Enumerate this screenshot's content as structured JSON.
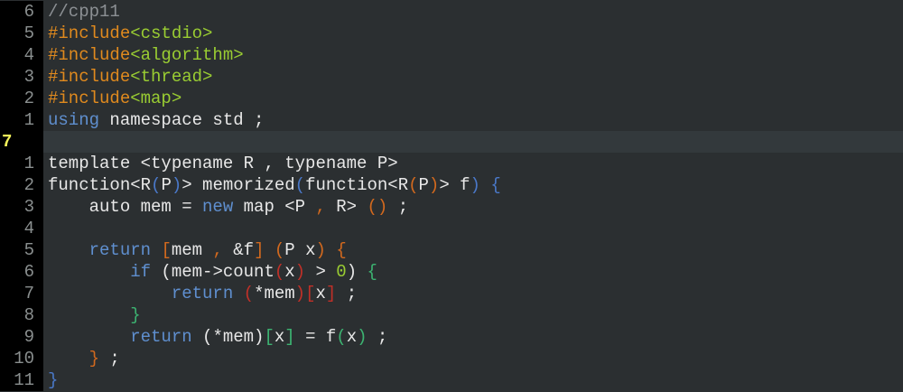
{
  "editor": {
    "colors": {
      "background": "#2b2f31",
      "gutter": "#000000",
      "current_line": "#33393c",
      "default_text": "#e8e8e8",
      "line_number": "#8a8f8f",
      "current_line_number": "#f4f35a",
      "comment": "#8c9094",
      "preproc": "#e08a1e",
      "header": "#9acd32",
      "keyword": "#5f8fcf",
      "paren_blue": "#4a78c8",
      "paren_orange": "#d2691e",
      "paren_red": "#c03028",
      "paren_green": "#3cb371",
      "number": "#9acd32"
    },
    "lines": [
      {
        "number": "6",
        "tokens": [
          {
            "t": "//cpp11",
            "c": "comment"
          }
        ]
      },
      {
        "number": "5",
        "tokens": [
          {
            "t": "#include",
            "c": "preproc"
          },
          {
            "t": "<cstdio>",
            "c": "header"
          }
        ]
      },
      {
        "number": "4",
        "tokens": [
          {
            "t": "#include",
            "c": "preproc"
          },
          {
            "t": "<algorithm>",
            "c": "header"
          }
        ]
      },
      {
        "number": "3",
        "tokens": [
          {
            "t": "#include",
            "c": "preproc"
          },
          {
            "t": "<thread>",
            "c": "header"
          }
        ]
      },
      {
        "number": "2",
        "tokens": [
          {
            "t": "#include",
            "c": "preproc"
          },
          {
            "t": "<map>",
            "c": "header"
          }
        ]
      },
      {
        "number": "1",
        "tokens": [
          {
            "t": "using",
            "c": "keyword"
          },
          {
            "t": " namespace std ;",
            "c": "default_text"
          }
        ]
      },
      {
        "number": "7",
        "current": true,
        "tokens": []
      },
      {
        "number": "1",
        "tokens": [
          {
            "t": "template <typename R , typename P>",
            "c": "default_text"
          }
        ]
      },
      {
        "number": "2",
        "tokens": [
          {
            "t": "function<R",
            "c": "default_text"
          },
          {
            "t": "(",
            "c": "paren_blue"
          },
          {
            "t": "P",
            "c": "default_text"
          },
          {
            "t": ")",
            "c": "paren_blue"
          },
          {
            "t": "> memorized",
            "c": "default_text"
          },
          {
            "t": "(",
            "c": "paren_blue"
          },
          {
            "t": "function<R",
            "c": "default_text"
          },
          {
            "t": "(",
            "c": "paren_orange"
          },
          {
            "t": "P",
            "c": "default_text"
          },
          {
            "t": ")",
            "c": "paren_orange"
          },
          {
            "t": "> f",
            "c": "default_text"
          },
          {
            "t": ")",
            "c": "paren_blue"
          },
          {
            "t": " ",
            "c": "default_text"
          },
          {
            "t": "{",
            "c": "paren_blue"
          }
        ]
      },
      {
        "number": "3",
        "tokens": [
          {
            "t": "    auto mem = ",
            "c": "default_text"
          },
          {
            "t": "new",
            "c": "keyword"
          },
          {
            "t": " map <P ",
            "c": "default_text"
          },
          {
            "t": ",",
            "c": "paren_orange"
          },
          {
            "t": " R> ",
            "c": "default_text"
          },
          {
            "t": "()",
            "c": "paren_orange"
          },
          {
            "t": " ;",
            "c": "default_text"
          }
        ]
      },
      {
        "number": "4",
        "tokens": []
      },
      {
        "number": "5",
        "tokens": [
          {
            "t": "    ",
            "c": "default_text"
          },
          {
            "t": "return",
            "c": "keyword"
          },
          {
            "t": " ",
            "c": "default_text"
          },
          {
            "t": "[",
            "c": "paren_orange"
          },
          {
            "t": "mem ",
            "c": "default_text"
          },
          {
            "t": ",",
            "c": "paren_orange"
          },
          {
            "t": " &f",
            "c": "default_text"
          },
          {
            "t": "]",
            "c": "paren_orange"
          },
          {
            "t": " ",
            "c": "default_text"
          },
          {
            "t": "(",
            "c": "paren_orange"
          },
          {
            "t": "P x",
            "c": "default_text"
          },
          {
            "t": ")",
            "c": "paren_orange"
          },
          {
            "t": " ",
            "c": "default_text"
          },
          {
            "t": "{",
            "c": "paren_orange"
          }
        ]
      },
      {
        "number": "6",
        "tokens": [
          {
            "t": "        ",
            "c": "default_text"
          },
          {
            "t": "if",
            "c": "keyword"
          },
          {
            "t": " (mem->count",
            "c": "default_text"
          },
          {
            "t": "(",
            "c": "paren_red"
          },
          {
            "t": "x",
            "c": "default_text"
          },
          {
            "t": ")",
            "c": "paren_red"
          },
          {
            "t": " > ",
            "c": "default_text"
          },
          {
            "t": "0",
            "c": "number"
          },
          {
            "t": ") ",
            "c": "default_text"
          },
          {
            "t": "{",
            "c": "paren_green"
          }
        ]
      },
      {
        "number": "7",
        "tokens": [
          {
            "t": "            ",
            "c": "default_text"
          },
          {
            "t": "return",
            "c": "keyword"
          },
          {
            "t": " ",
            "c": "default_text"
          },
          {
            "t": "(",
            "c": "paren_red"
          },
          {
            "t": "*mem",
            "c": "default_text"
          },
          {
            "t": ")",
            "c": "paren_red"
          },
          {
            "t": "[",
            "c": "paren_red"
          },
          {
            "t": "x",
            "c": "default_text"
          },
          {
            "t": "]",
            "c": "paren_red"
          },
          {
            "t": " ;",
            "c": "default_text"
          }
        ]
      },
      {
        "number": "8",
        "tokens": [
          {
            "t": "        ",
            "c": "default_text"
          },
          {
            "t": "}",
            "c": "paren_green"
          }
        ]
      },
      {
        "number": "9",
        "tokens": [
          {
            "t": "        ",
            "c": "default_text"
          },
          {
            "t": "return",
            "c": "keyword"
          },
          {
            "t": " (*mem)",
            "c": "default_text"
          },
          {
            "t": "[",
            "c": "paren_green"
          },
          {
            "t": "x",
            "c": "default_text"
          },
          {
            "t": "]",
            "c": "paren_green"
          },
          {
            "t": " = f",
            "c": "default_text"
          },
          {
            "t": "(",
            "c": "paren_green"
          },
          {
            "t": "x",
            "c": "default_text"
          },
          {
            "t": ")",
            "c": "paren_green"
          },
          {
            "t": " ;",
            "c": "default_text"
          }
        ]
      },
      {
        "number": "10",
        "tokens": [
          {
            "t": "    ",
            "c": "default_text"
          },
          {
            "t": "}",
            "c": "paren_orange"
          },
          {
            "t": " ;",
            "c": "default_text"
          }
        ]
      },
      {
        "number": "11",
        "tokens": [
          {
            "t": "}",
            "c": "paren_blue"
          }
        ]
      }
    ]
  }
}
